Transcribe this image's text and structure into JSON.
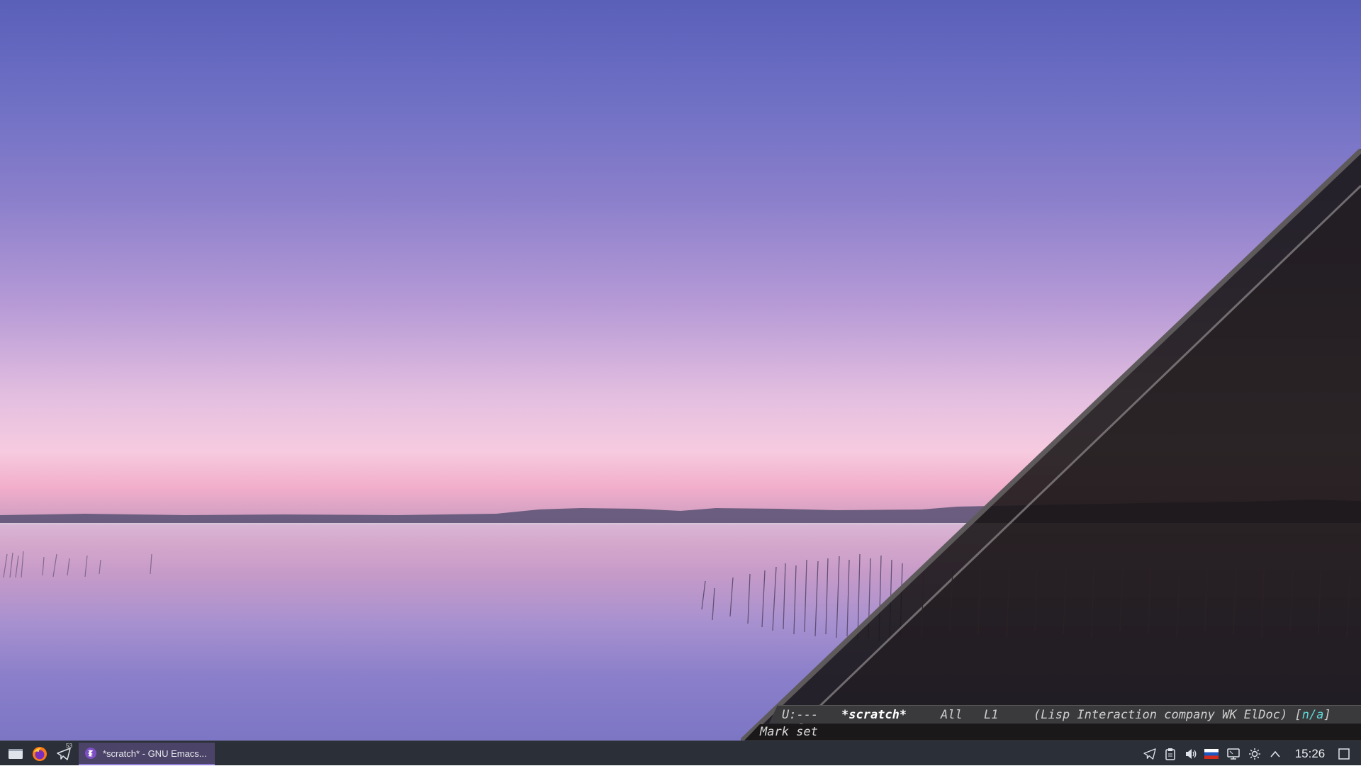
{
  "emacs": {
    "modeline": {
      "state": "U:---",
      "buffer": "*scratch*",
      "position": "All",
      "line": "L1",
      "mode_prefix": "(Lisp Interaction company WK ElDoc) [",
      "mode_na": "n/a",
      "mode_suffix": "]"
    },
    "minibuffer": "Mark set"
  },
  "taskbar": {
    "launchers": [
      {
        "name": "show-desktop",
        "icon": "desktop-icon"
      },
      {
        "name": "firefox",
        "icon": "firefox-icon"
      },
      {
        "name": "telegram",
        "icon": "telegram-icon",
        "badge": "53"
      }
    ],
    "active_task": {
      "label": "*scratch* - GNU Emacs...",
      "icon": "emacs-icon"
    },
    "tray": [
      "telegram-icon",
      "clipboard-icon",
      "volume-icon",
      "keyboard-layout-flag-icon",
      "network-icon",
      "brightness-icon",
      "chevron-up-icon"
    ],
    "clock": "15:26"
  },
  "colors": {
    "taskbar_bg": "#2b2f37",
    "active_task_bg": "#4b4468",
    "modeline_bg": "#3a3a3c",
    "emacs_bg": "#1b1819",
    "accent_cyan": "#5fd7d7"
  }
}
